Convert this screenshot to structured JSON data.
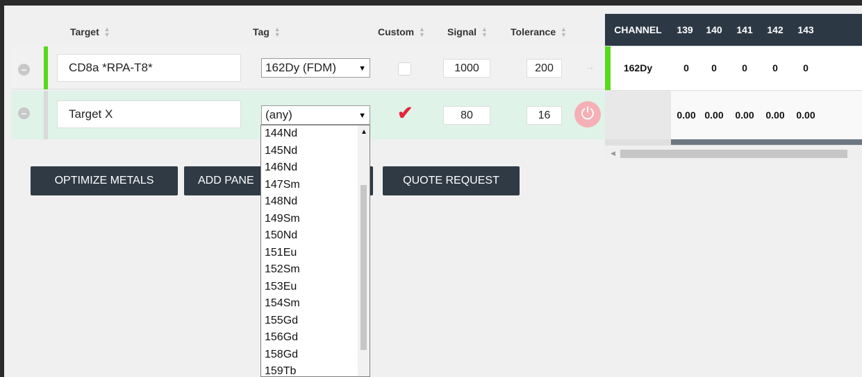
{
  "columns": {
    "target": "Target",
    "tag": "Tag",
    "custom": "Custom",
    "signal": "Signal",
    "tolerance": "Tolerance"
  },
  "rows": [
    {
      "target": "CD8a *RPA-T8*",
      "tag": "162Dy (FDM)",
      "custom": false,
      "signal": "1000",
      "tolerance": "200"
    },
    {
      "target": "Target X",
      "tag": "(any)",
      "custom": true,
      "signal": "80",
      "tolerance": "16"
    }
  ],
  "buttons": {
    "optimize": "OPTIMIZE METALS",
    "add_panel": "ADD PANE",
    "quote": "QUOTE REQUEST"
  },
  "dropdown": {
    "options": [
      "144Nd",
      "145Nd",
      "146Nd",
      "147Sm",
      "148Nd",
      "149Sm",
      "150Nd",
      "151Eu",
      "152Sm",
      "153Eu",
      "154Sm",
      "155Gd",
      "156Gd",
      "158Gd",
      "159Tb"
    ]
  },
  "channel_table": {
    "header": "CHANNEL",
    "channels": [
      "139",
      "140",
      "141",
      "142",
      "143"
    ],
    "rows": [
      {
        "label": "162Dy",
        "values": [
          "0",
          "0",
          "0",
          "0",
          "0"
        ]
      },
      {
        "label": "",
        "values": [
          "0.00",
          "0.00",
          "0.00",
          "0.00",
          "0.00"
        ]
      }
    ]
  },
  "colors": {
    "accent_green": "#57d91c",
    "dark_header": "#2d3845",
    "checkmark_red": "#e3263b",
    "power_pink": "#f4b0b6"
  },
  "icons": {
    "sort": "sort-icon",
    "remove": "remove-icon",
    "arrow": "arrow-right-icon",
    "power": "power-icon",
    "check": "checkmark-icon"
  }
}
